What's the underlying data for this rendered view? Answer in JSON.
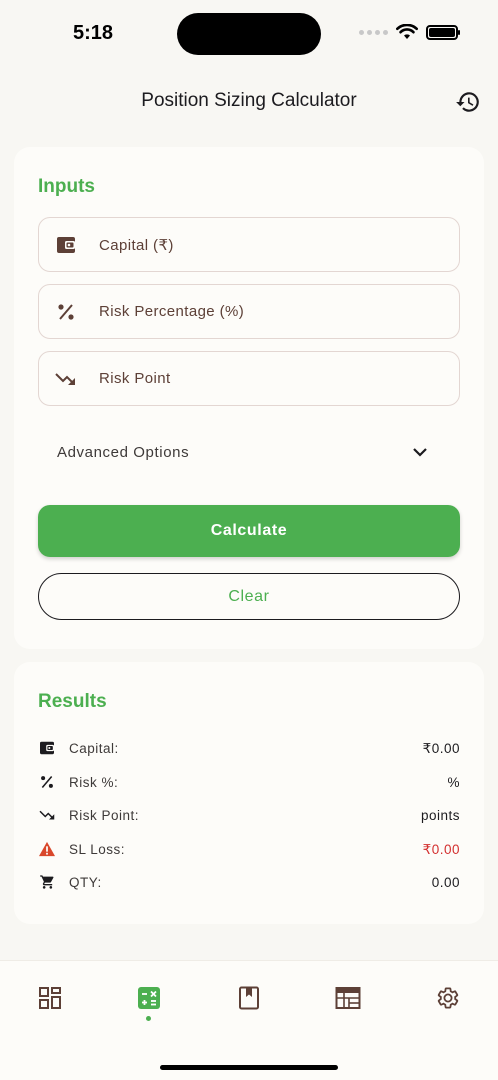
{
  "status_bar": {
    "time": "5:18"
  },
  "app_bar": {
    "title": "Position Sizing Calculator",
    "history_icon": "history-icon"
  },
  "inputs": {
    "title": "Inputs",
    "fields": [
      {
        "label": "Capital (₹)",
        "icon": "wallet-icon"
      },
      {
        "label": "Risk Percentage (%)",
        "icon": "percent-icon"
      },
      {
        "label": "Risk Point",
        "icon": "trending-down-icon"
      }
    ],
    "advanced_label": "Advanced Options",
    "calculate_label": "Calculate",
    "clear_label": "Clear"
  },
  "results": {
    "title": "Results",
    "rows": [
      {
        "label": "Capital:",
        "value": "₹0.00",
        "icon": "wallet-icon"
      },
      {
        "label": "Risk %:",
        "value": "%",
        "icon": "percent-icon"
      },
      {
        "label": "Risk Point:",
        "value": "points",
        "icon": "trending-down-icon"
      },
      {
        "label": "SL Loss:",
        "value": "₹0.00",
        "icon": "warning-icon"
      },
      {
        "label": "QTY:",
        "value": "0.00",
        "icon": "cart-icon"
      }
    ]
  },
  "bottom_nav": {
    "items": [
      {
        "icon": "dashboard-icon"
      },
      {
        "icon": "calculator-icon",
        "active": true
      },
      {
        "icon": "book-icon"
      },
      {
        "icon": "calendar-icon"
      },
      {
        "icon": "settings-icon"
      }
    ]
  },
  "colors": {
    "accent": "#4caf50",
    "danger": "#d32f2f",
    "brown": "#5d4037",
    "background": "#f8f7f3"
  }
}
